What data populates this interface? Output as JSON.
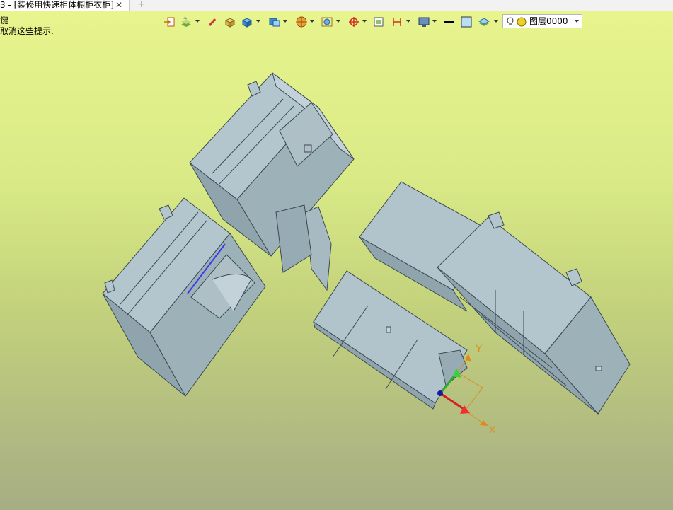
{
  "tab": {
    "title": "3 - [装修用快速柜体橱柜衣柜]",
    "close": "✕",
    "new": "+"
  },
  "hints": {
    "line1": "键",
    "line2": "取消这些提示."
  },
  "layer": {
    "label": "图层0000"
  },
  "axes": {
    "x_label": "X",
    "y_label": "Y"
  },
  "toolbar_icons": [
    "import-icon",
    "layer-filter-icon",
    "pencil-icon",
    "box-icon",
    "solid-cube-icon",
    "render-mode-icon",
    "sphere-icon",
    "view-icon",
    "snap-icon",
    "frame-icon",
    "dimension-icon",
    "display-icon",
    "line-color-icon",
    "fill-color-icon",
    "stack-icon",
    "bulb-icon",
    "layer-color-icon"
  ],
  "colors": {
    "background_top": "#e9f58e",
    "background_bottom": "#a6ad84",
    "model": "#9fb3bb",
    "model_edge": "#3a4a52"
  }
}
